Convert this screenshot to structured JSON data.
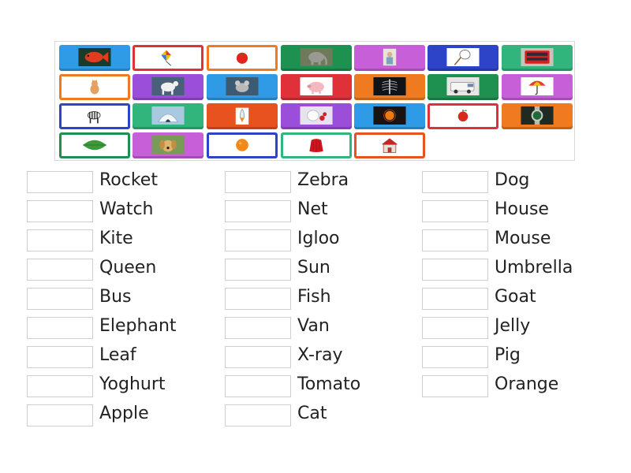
{
  "tiles": [
    {
      "picture": "fish-picture",
      "bg": "#2f9be6",
      "style": "solid"
    },
    {
      "picture": "kite-picture",
      "bg": "#e0303a",
      "style": "outline"
    },
    {
      "picture": "tomato-picture",
      "bg": "#f07a1f",
      "style": "outline"
    },
    {
      "picture": "elephant-picture",
      "bg": "#1e9150",
      "style": "solid"
    },
    {
      "picture": "queen-picture",
      "bg": "#c65fd8",
      "style": "solid"
    },
    {
      "picture": "net-picture",
      "bg": "#2d44c9",
      "style": "solid"
    },
    {
      "picture": "bus-picture",
      "bg": "#31b57c",
      "style": "solid"
    },
    {
      "picture": "cat-picture",
      "bg": "#f07a1f",
      "style": "outline"
    },
    {
      "picture": "goat-picture",
      "bg": "#9b4ed9",
      "style": "solid"
    },
    {
      "picture": "mouse-picture",
      "bg": "#2f9be6",
      "style": "solid"
    },
    {
      "picture": "pig-picture",
      "bg": "#e0303a",
      "style": "solid"
    },
    {
      "picture": "xray-picture",
      "bg": "#f07a1f",
      "style": "solid"
    },
    {
      "picture": "van-picture",
      "bg": "#1e9150",
      "style": "solid"
    },
    {
      "picture": "umbrella-picture",
      "bg": "#c65fd8",
      "style": "solid"
    },
    {
      "picture": "zebra-picture",
      "bg": "#2d44c9",
      "style": "outline"
    },
    {
      "picture": "igloo-picture",
      "bg": "#31b57c",
      "style": "solid"
    },
    {
      "picture": "rocket-picture",
      "bg": "#e8521e",
      "style": "solid"
    },
    {
      "picture": "yoghurt-picture",
      "bg": "#9b4ed9",
      "style": "solid"
    },
    {
      "picture": "sun-picture",
      "bg": "#2f9be6",
      "style": "solid"
    },
    {
      "picture": "apple-picture",
      "bg": "#e0303a",
      "style": "outline"
    },
    {
      "picture": "watch-picture",
      "bg": "#f07a1f",
      "style": "solid"
    },
    {
      "picture": "leaf-picture",
      "bg": "#1e9150",
      "style": "outline"
    },
    {
      "picture": "dog-picture",
      "bg": "#c65fd8",
      "style": "solid"
    },
    {
      "picture": "orange-picture",
      "bg": "#2d44c9",
      "style": "outline"
    },
    {
      "picture": "jelly-picture",
      "bg": "#31b57c",
      "style": "outline"
    },
    {
      "picture": "house-picture",
      "bg": "#e8521e",
      "style": "outline"
    }
  ],
  "columns": [
    {
      "words": [
        "Rocket",
        "Watch",
        "Kite",
        "Queen",
        "Bus",
        "Elephant",
        "Leaf",
        "Yoghurt",
        "Apple"
      ]
    },
    {
      "words": [
        "Zebra",
        "Net",
        "Igloo",
        "Sun",
        "Fish",
        "Van",
        "X-ray",
        "Tomato",
        "Cat"
      ]
    },
    {
      "words": [
        "Dog",
        "House",
        "Mouse",
        "Umbrella",
        "Goat",
        "Jelly",
        "Pig",
        "Orange"
      ]
    }
  ]
}
